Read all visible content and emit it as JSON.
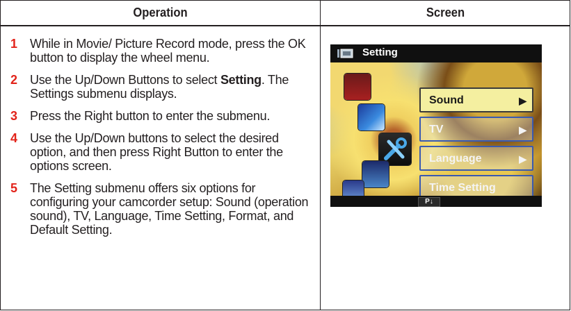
{
  "table": {
    "header_operation": "Operation",
    "header_screen": "Screen"
  },
  "steps": [
    {
      "num": "1",
      "text": "While in Movie/ Picture Record mode, press the OK button to display the wheel menu."
    },
    {
      "num": "2",
      "pre": "Use the Up/Down Buttons to select ",
      "bold": "Setting",
      "post": ". The Settings submenu displays."
    },
    {
      "num": "3",
      "text": "Press the Right button to enter the submenu."
    },
    {
      "num": "4",
      "text": "Use the Up/Down buttons to select the desired option, and then press Right Button to enter the options screen."
    },
    {
      "num": "5",
      "text": "The Setting submenu offers six options for configuring your camcorder setup: Sound (operation sound), TV, Language, Time Setting, Format, and Default Setting."
    }
  ],
  "camera_screen": {
    "title": "Setting",
    "menu": [
      {
        "label": "Sound",
        "arrow": "▶",
        "selected": true
      },
      {
        "label": "TV",
        "arrow": "▶",
        "selected": false
      },
      {
        "label": "Language",
        "arrow": "▶",
        "selected": false
      },
      {
        "label": "Time Setting",
        "arrow": "",
        "selected": false
      }
    ],
    "page_badge": "P↓",
    "tile_icons": [
      "wb-icon",
      "exposure-icon",
      "setting-tools-icon",
      "movie-icon",
      "night-mode-icon"
    ],
    "colors": {
      "selected_bg": "#f4efa0",
      "item_border": "#3a5ab0",
      "accent_red": "#e2231a"
    }
  }
}
